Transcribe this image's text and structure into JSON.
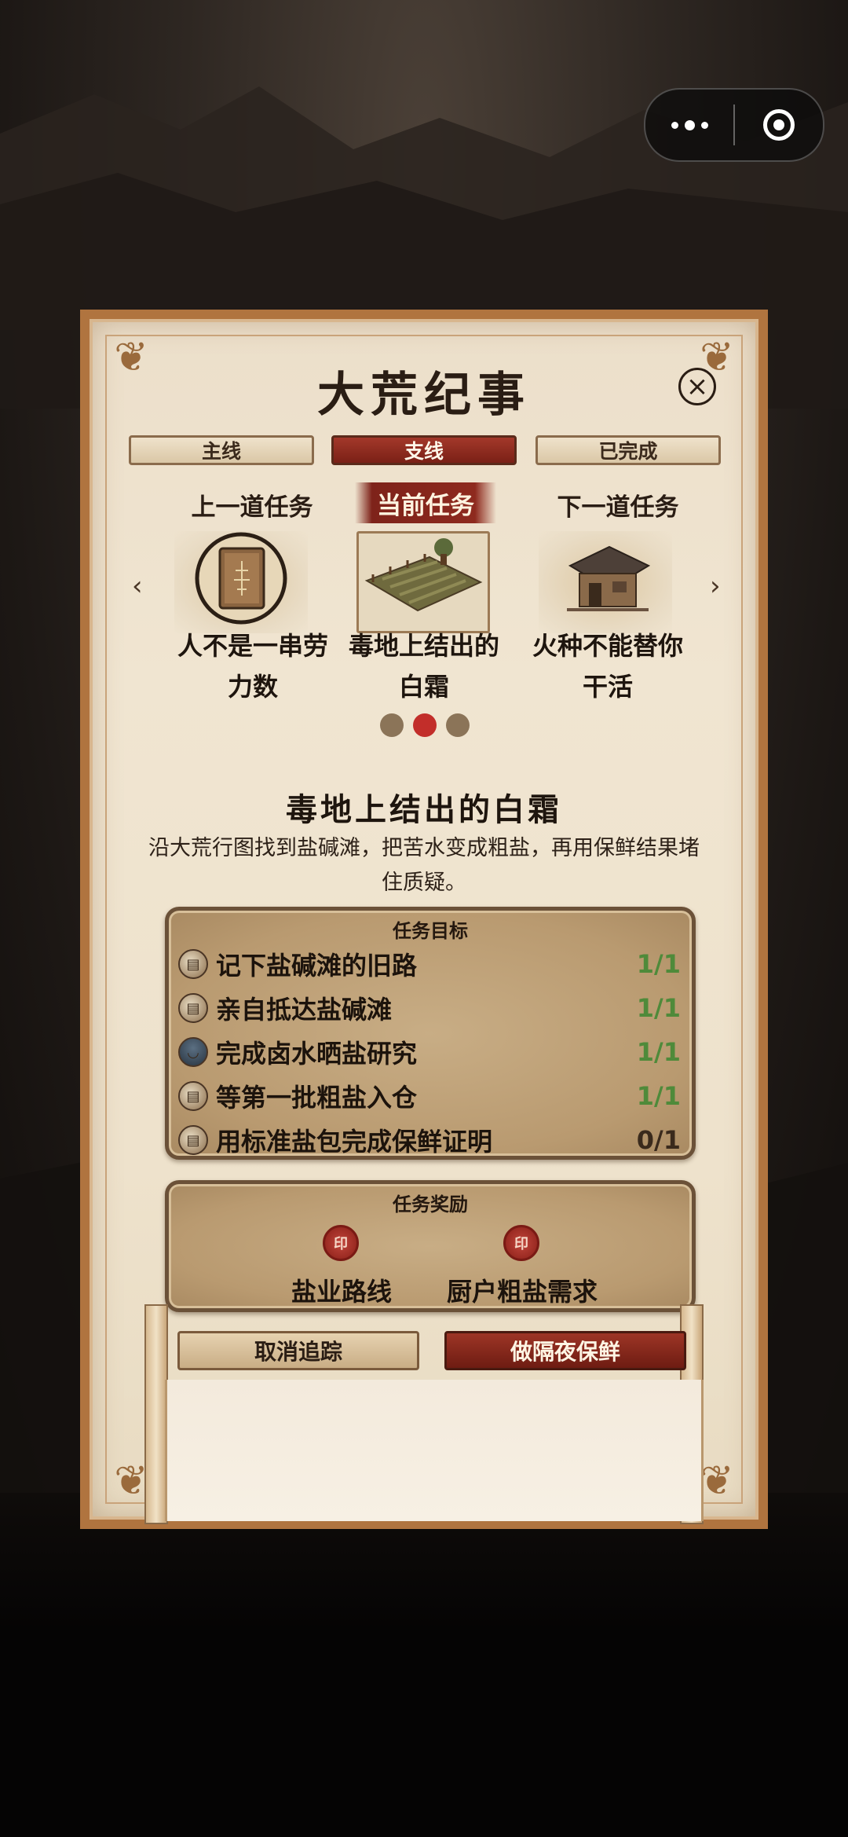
{
  "window": {
    "title": "大荒纪事"
  },
  "capsule": {
    "more_icon": "more-dots-icon",
    "close_icon": "target-circle-icon"
  },
  "tabs": [
    {
      "label": "主线",
      "active": false
    },
    {
      "label": "支线",
      "active": true
    },
    {
      "label": "已完成",
      "active": false
    }
  ],
  "carousel": {
    "prev_label": "上一道任务",
    "current_label": "当前任务",
    "next_label": "下一道任务",
    "prev_task": {
      "name": "人不是一串劳力数",
      "icon": "book-icon"
    },
    "current_task": {
      "name": "毒地上结出的白霜",
      "icon": "salt-field-icon"
    },
    "next_task": {
      "name": "火种不能替你干活",
      "icon": "house-icon"
    },
    "left_arrow": "‹",
    "right_arrow": "›",
    "page_index": 2,
    "page_count": 3
  },
  "quest": {
    "title": "毒地上结出的白霜",
    "description": "沿大荒行图找到盐碱滩，把苦水变成粗盐，再用保鲜结果堵住质疑。"
  },
  "objectives": {
    "title": "任务目标",
    "items": [
      {
        "icon": "scroll-icon",
        "text": "记下盐碱滩的旧路",
        "progress": "1/1",
        "done": true
      },
      {
        "icon": "scroll-icon",
        "text": "亲自抵达盐碱滩",
        "progress": "1/1",
        "done": true
      },
      {
        "icon": "bowl-icon",
        "text": "完成卤水晒盐研究",
        "progress": "1/1",
        "done": true
      },
      {
        "icon": "scroll-icon",
        "text": "等第一批粗盐入仓",
        "progress": "1/1",
        "done": true
      },
      {
        "icon": "scroll-icon",
        "text": "用标准盐包完成保鲜证明",
        "progress": "0/1",
        "done": false
      }
    ]
  },
  "rewards": {
    "title": "任务奖励",
    "items": [
      {
        "icon": "seal-icon",
        "name": "盐业路线"
      },
      {
        "icon": "seal-icon",
        "name": "厨户粗盐需求"
      }
    ]
  },
  "actions": {
    "cancel_label": "取消追踪",
    "primary_label": "做隔夜保鲜"
  },
  "colors": {
    "accent_red": "#8e2a1e",
    "done_green": "#4f8a3a",
    "frame_brown": "#b0743f"
  }
}
